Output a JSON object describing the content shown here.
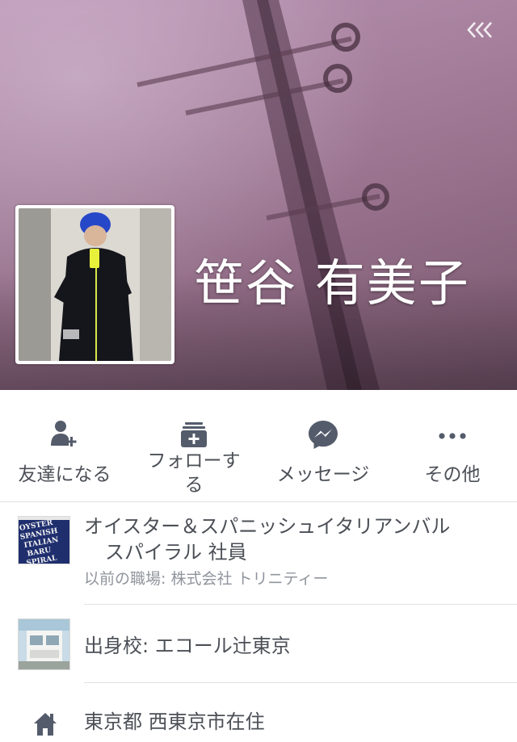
{
  "profile": {
    "name": "笹谷 有美子"
  },
  "actions": [
    {
      "icon": "add-friend-icon",
      "label": "友達になる"
    },
    {
      "icon": "follow-icon",
      "label": "フォローする"
    },
    {
      "icon": "messenger-icon",
      "label": "メッセージ"
    },
    {
      "icon": "more-icon",
      "label": "その他"
    }
  ],
  "work": {
    "employer_line1": "オイスター＆スパニッシュイタリアンバル",
    "employer_line2": "スパイラル 社員",
    "previous": "以前の職場: 株式会社 トリニティー",
    "logo_text": [
      "OYSTER",
      "SPANISH",
      "ITALIAN",
      "BARU",
      "SPIRAL"
    ]
  },
  "education": {
    "school": "出身校: エコール辻東京"
  },
  "location": {
    "lives_in": "東京都 西東京市在住"
  },
  "colors": {
    "icon": "#545c6b",
    "text": "#4b4f56",
    "secondary": "#90949c",
    "cover": "#a8829f",
    "logo_bg": "#1f2f6e"
  }
}
